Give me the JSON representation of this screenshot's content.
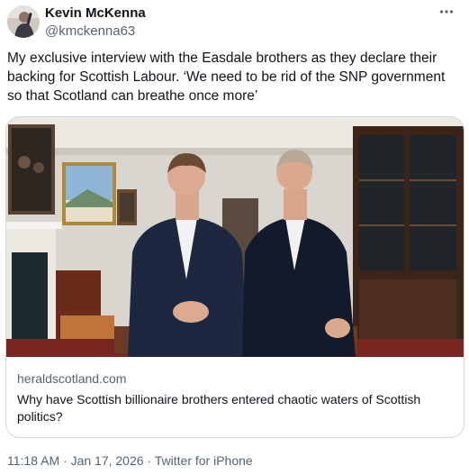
{
  "author": {
    "display_name": "Kevin McKenna",
    "handle": "@kmckenna63"
  },
  "more_icon": "more-horizontal-icon",
  "tweet": {
    "text": "My exclusive interview with the Easdale brothers as they declare their backing for Scottish Labour. ‘We need to be rid of the SNP government so that Scotland can breathe once more’"
  },
  "card": {
    "domain": "heraldscotland.com",
    "title": "Why have Scottish billionaire brothers entered chaotic waters of Scottish politics?"
  },
  "meta": {
    "time": "11:18 AM",
    "separator1": " · ",
    "date": "Jan 17, 2026",
    "separator2": " · ",
    "source": "Twitter for iPhone"
  },
  "colors": {
    "text": "#0f1419",
    "secondary": "#536471",
    "border": "#cfd9de"
  }
}
